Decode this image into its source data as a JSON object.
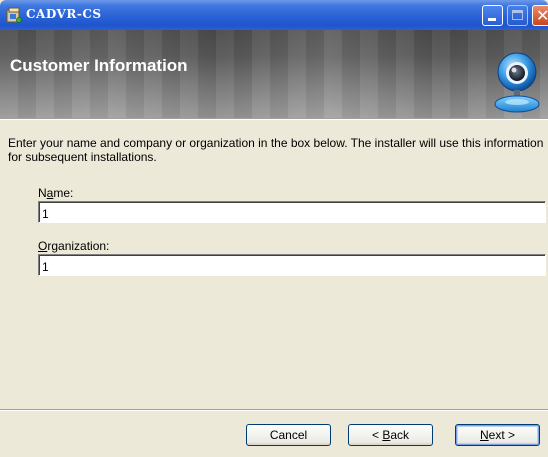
{
  "window": {
    "title": "CADVR-CS",
    "icons": [
      "installer-icon",
      "minimize-icon",
      "maximize-icon",
      "close-icon"
    ]
  },
  "banner": {
    "title": "Customer Information",
    "logo_icon": "webcam-icon"
  },
  "body": {
    "instructions": "Enter your name and company or organization in the box below. The installer will use this information for subsequent installations.",
    "name_label_pre": "N",
    "name_label_mnemonic": "a",
    "name_label_post": "me:",
    "name_value": "1",
    "org_label_mnemonic": "O",
    "org_label_post": "rganization:",
    "org_value": "1"
  },
  "buttons": {
    "cancel": "Cancel",
    "back_pre": "< ",
    "back_mnemonic": "B",
    "back_post": "ack",
    "next_mnemonic": "N",
    "next_post": "ext >"
  },
  "colors": {
    "titlebar": "#2a62d6",
    "window_bg": "#ece9d8",
    "banner": "#5a5a5a"
  }
}
